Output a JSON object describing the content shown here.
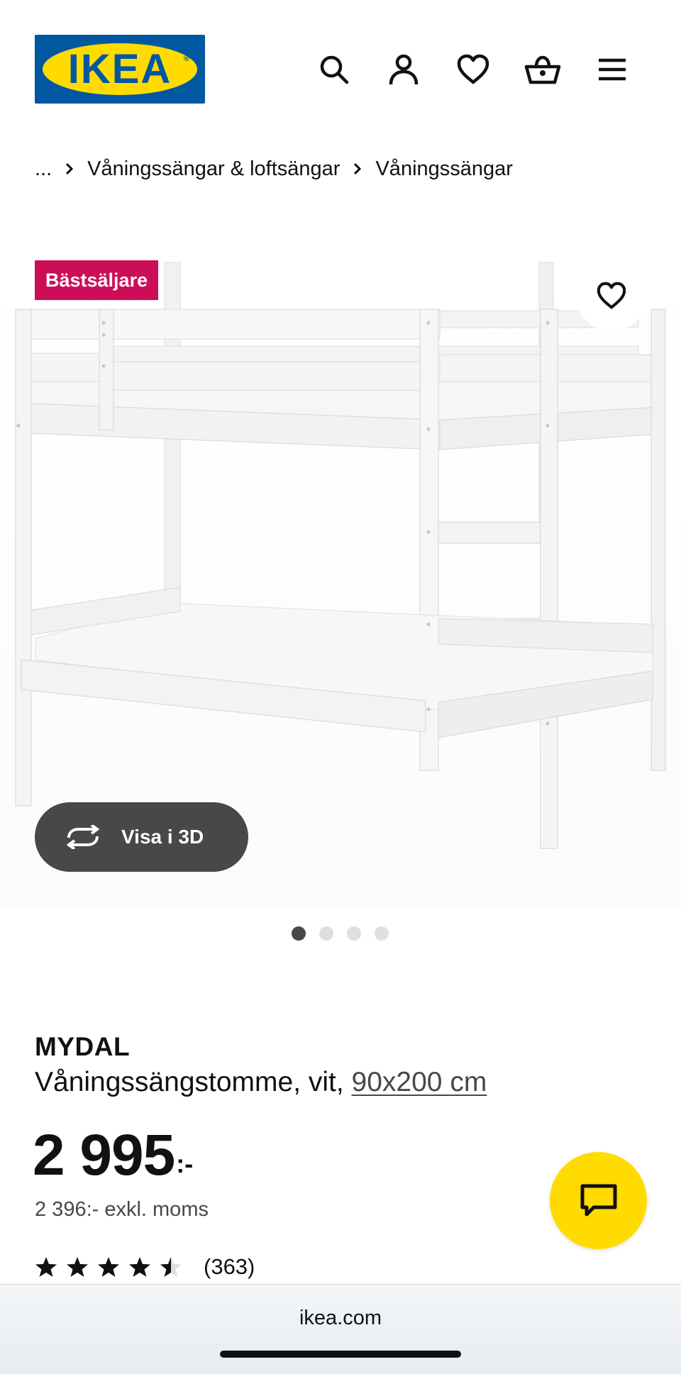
{
  "header": {
    "logo_text": "IKEA",
    "icons": [
      "search-icon",
      "account-icon",
      "heart-icon",
      "basket-icon",
      "menu-icon"
    ]
  },
  "breadcrumb": {
    "ellipsis": "...",
    "items": [
      "Våningssängar & loftsängar",
      "Våningssängar"
    ]
  },
  "media": {
    "badge": "Bästsäljare",
    "view_3d_label": "Visa i 3D",
    "image_count": 4,
    "active_image": 1
  },
  "product": {
    "name": "MYDAL",
    "description": "Våningssängstomme, vit,",
    "size": "90x200 cm",
    "price_integer": "2 995",
    "price_suffix": ":-",
    "price_excl_vat": "2 396:- exkl. moms",
    "rating": 4.5,
    "review_count": "(363)"
  },
  "browser": {
    "url": "ikea.com"
  },
  "colors": {
    "brand_blue": "#0058a3",
    "brand_yellow": "#ffdb00",
    "badge_red": "#cc0e59",
    "dark_gray": "#484848"
  }
}
